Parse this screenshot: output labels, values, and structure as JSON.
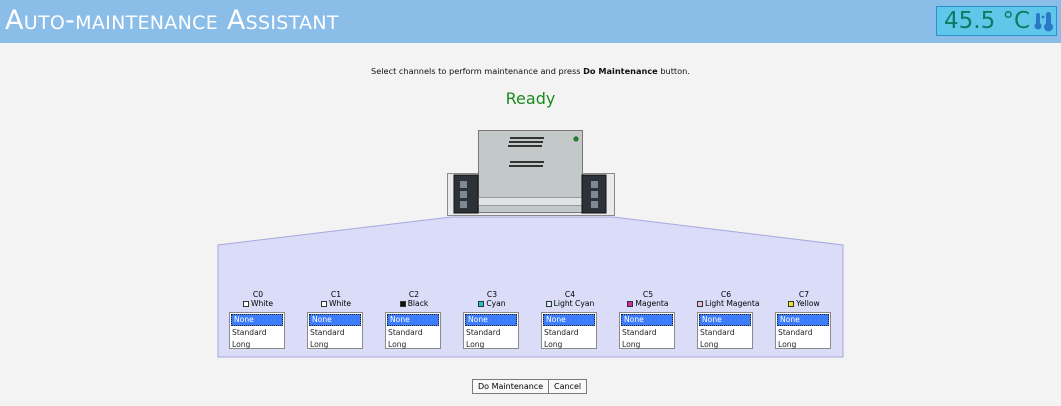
{
  "header": {
    "title": "Auto-maintenance Assistant",
    "temperature": "45.5 °C",
    "temperature_icon": "thermometer-icon"
  },
  "main": {
    "instruction_prefix": "Select channels to perform maintenance and press ",
    "instruction_bold": "Do Maintenance",
    "instruction_suffix": " button.",
    "status": "Ready"
  },
  "channels": [
    {
      "id": "C0",
      "color_name": "White",
      "swatch": "#ffffff"
    },
    {
      "id": "C1",
      "color_name": "White",
      "swatch": "#ffffff"
    },
    {
      "id": "C2",
      "color_name": "Black",
      "swatch": "#111111"
    },
    {
      "id": "C3",
      "color_name": "Cyan",
      "swatch": "#21c3c9"
    },
    {
      "id": "C4",
      "color_name": "Light Cyan",
      "swatch": "#c8f0f0"
    },
    {
      "id": "C5",
      "color_name": "Magenta",
      "swatch": "#d42aa8"
    },
    {
      "id": "C6",
      "color_name": "Light Magenta",
      "swatch": "#f1bde6"
    },
    {
      "id": "C7",
      "color_name": "Yellow",
      "swatch": "#f2e11a"
    }
  ],
  "options": [
    "None",
    "Standard",
    "Long"
  ],
  "selected_option": "None",
  "buttons": {
    "do_maintenance": "Do Maintenance",
    "cancel": "Cancel"
  },
  "colors": {
    "header_bg": "#8bbde9",
    "temp_bg": "#61c7ea",
    "status_green": "#1c8a1c",
    "panel_fill": "#dadcf8",
    "selection_blue": "#3d7dfb"
  }
}
